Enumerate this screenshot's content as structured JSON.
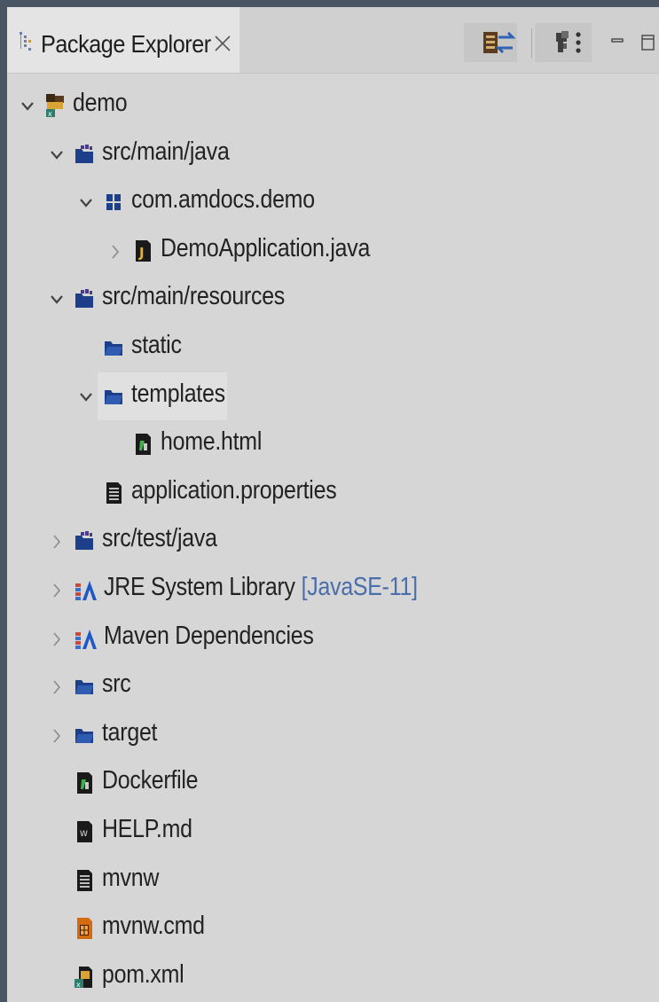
{
  "view": {
    "tab_title": "Package Explorer"
  },
  "tree": [
    {
      "label": "demo",
      "decoration": "",
      "expanded": true,
      "hasChevron": true,
      "level": 0,
      "icon": "project-icon"
    },
    {
      "label": "src/main/java",
      "decoration": "",
      "expanded": true,
      "hasChevron": true,
      "level": 1,
      "icon": "source-folder-icon"
    },
    {
      "label": "com.amdocs.demo",
      "decoration": "",
      "expanded": true,
      "hasChevron": true,
      "level": 2,
      "icon": "package-icon"
    },
    {
      "label": "DemoApplication.java",
      "decoration": "",
      "expanded": false,
      "hasChevron": true,
      "level": 3,
      "icon": "java-file-icon"
    },
    {
      "label": "src/main/resources",
      "decoration": "",
      "expanded": true,
      "hasChevron": true,
      "level": 1,
      "icon": "source-folder-icon"
    },
    {
      "label": "static",
      "decoration": "",
      "expanded": false,
      "hasChevron": false,
      "level": 2,
      "icon": "folder-icon"
    },
    {
      "label": "templates",
      "decoration": "",
      "expanded": true,
      "hasChevron": true,
      "level": 2,
      "icon": "folder-icon",
      "hovered": true
    },
    {
      "label": "home.html",
      "decoration": "",
      "expanded": false,
      "hasChevron": false,
      "level": 3,
      "icon": "html-file-icon"
    },
    {
      "label": "application.properties",
      "decoration": "",
      "expanded": false,
      "hasChevron": false,
      "level": 2,
      "icon": "text-file-icon"
    },
    {
      "label": "src/test/java",
      "decoration": "",
      "expanded": false,
      "hasChevron": true,
      "level": 1,
      "icon": "source-folder-icon"
    },
    {
      "label": "JRE System Library",
      "decoration": "[JavaSE-11]",
      "expanded": false,
      "hasChevron": true,
      "level": 1,
      "icon": "library-icon"
    },
    {
      "label": "Maven Dependencies",
      "decoration": "",
      "expanded": false,
      "hasChevron": true,
      "level": 1,
      "icon": "library-icon"
    },
    {
      "label": "src",
      "decoration": "",
      "expanded": false,
      "hasChevron": true,
      "level": 1,
      "icon": "folder-icon"
    },
    {
      "label": "target",
      "decoration": "",
      "expanded": false,
      "hasChevron": true,
      "level": 1,
      "icon": "folder-icon"
    },
    {
      "label": "Dockerfile",
      "decoration": "",
      "expanded": false,
      "hasChevron": false,
      "level": 1,
      "icon": "html-file-icon"
    },
    {
      "label": "HELP.md",
      "decoration": "",
      "expanded": false,
      "hasChevron": false,
      "level": 1,
      "icon": "markdown-file-icon"
    },
    {
      "label": "mvnw",
      "decoration": "",
      "expanded": false,
      "hasChevron": false,
      "level": 1,
      "icon": "text-file-icon"
    },
    {
      "label": "mvnw.cmd",
      "decoration": "",
      "expanded": false,
      "hasChevron": false,
      "level": 1,
      "icon": "cmd-file-icon"
    },
    {
      "label": "pom.xml",
      "decoration": "",
      "expanded": false,
      "hasChevron": false,
      "level": 1,
      "icon": "xml-file-icon"
    }
  ],
  "toolbar": {
    "buttons": [
      "collapse-all-icon",
      "link-with-editor-icon",
      "filters-icon",
      "view-menu-icon",
      "minimize-icon",
      "maximize-icon"
    ]
  },
  "colors": {
    "background": "#d6d6d6",
    "tab_active": "#e4e4e4",
    "folder_blue": "#1d3f8a",
    "decoration_blue": "#4a6ea9",
    "text": "#222222"
  }
}
